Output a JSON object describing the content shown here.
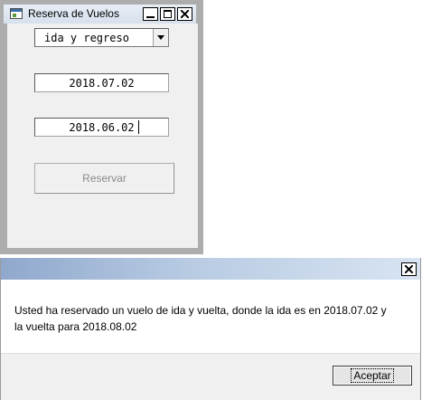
{
  "flight_window": {
    "title": "Reserva de Vuelos",
    "trip_type_selected": "ida y regreso",
    "departure_date": "2018.07.02",
    "return_date": "2018.06.02",
    "reserve_label": "Reservar"
  },
  "message_dialog": {
    "message": "Usted ha reservado un vuelo de ida y vuelta, donde la ida es en 2018.07.02 y la vuelta para 2018.08.02",
    "accept_label": "Aceptar"
  }
}
